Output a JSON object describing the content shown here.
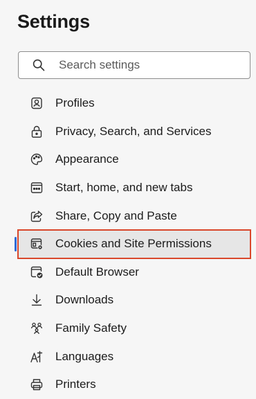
{
  "header": {
    "title": "Settings"
  },
  "search": {
    "placeholder": "Search settings",
    "value": ""
  },
  "nav": {
    "selected_index": 5,
    "items": [
      {
        "label": "Profiles",
        "icon": "profile-icon"
      },
      {
        "label": "Privacy, Search, and Services",
        "icon": "lock-icon"
      },
      {
        "label": "Appearance",
        "icon": "palette-icon"
      },
      {
        "label": "Start, home, and new tabs",
        "icon": "start-page-icon"
      },
      {
        "label": "Share, Copy and Paste",
        "icon": "share-icon"
      },
      {
        "label": "Cookies and Site Permissions",
        "icon": "cookies-permissions-icon"
      },
      {
        "label": "Default Browser",
        "icon": "default-browser-icon"
      },
      {
        "label": "Downloads",
        "icon": "download-icon"
      },
      {
        "label": "Family Safety",
        "icon": "family-icon"
      },
      {
        "label": "Languages",
        "icon": "languages-icon"
      },
      {
        "label": "Printers",
        "icon": "printer-icon"
      }
    ]
  },
  "colors": {
    "selection_outline": "#d9472b",
    "selection_indicator": "#2f6bd6",
    "background": "#f6f6f6"
  }
}
